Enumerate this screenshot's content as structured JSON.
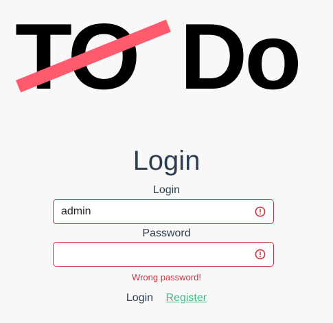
{
  "logo": {
    "first_word": "TO",
    "second_word": "Do",
    "strike_color": "#ff5a6e"
  },
  "page_title": "Login",
  "form": {
    "login_label": "Login",
    "login_value": "admin",
    "password_label": "Password",
    "password_value": "",
    "error_icon": "exclamation-circle-icon",
    "error_color": "#d0313f",
    "error_message": "Wrong password!"
  },
  "actions": {
    "login_label": "Login",
    "register_label": "Register",
    "register_color": "#42b983"
  }
}
